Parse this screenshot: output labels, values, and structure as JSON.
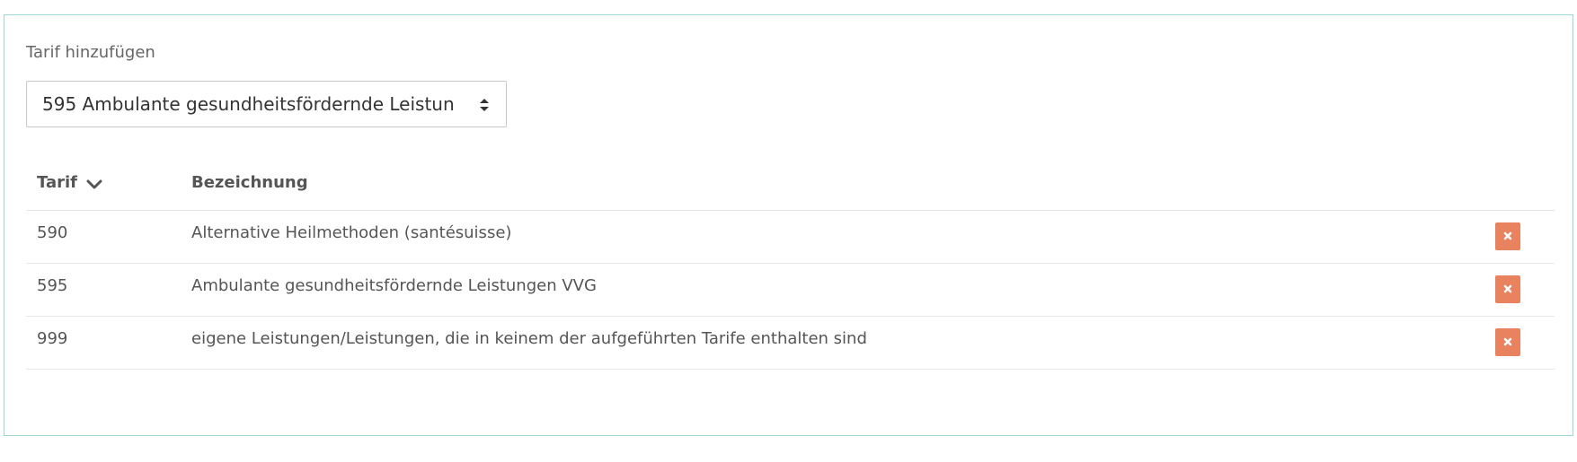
{
  "form": {
    "label": "Tarif hinzufügen",
    "select_value": "595 Ambulante gesundheitsfördernde Leistun",
    "select_icon": "sort-arrows-icon"
  },
  "table": {
    "headers": {
      "tarif": "Tarif",
      "bezeichnung": "Bezeichnung",
      "sort_icon": "chevron-down-icon"
    },
    "rows": [
      {
        "tarif": "590",
        "bezeichnung": "Alternative Heilmethoden (santésuisse)"
      },
      {
        "tarif": "595",
        "bezeichnung": "Ambulante gesundheitsfördernde Leistungen VVG"
      },
      {
        "tarif": "999",
        "bezeichnung": "eigene Leistungen/Leistungen, die in keinem der aufgeführten Tarife enthalten sind"
      }
    ],
    "delete_icon": "close-icon"
  },
  "colors": {
    "panel_border": "#9fd6d6",
    "delete_button": "#e8825f",
    "text": "#555555"
  }
}
